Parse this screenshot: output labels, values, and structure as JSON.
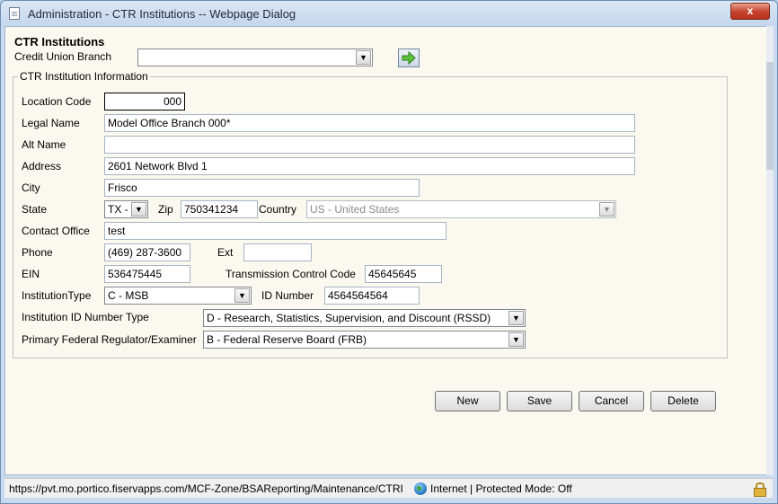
{
  "window": {
    "title": "Administration - CTR Institutions -- Webpage Dialog",
    "close_label": "x"
  },
  "page": {
    "heading": "CTR Institutions",
    "branch_label": "Credit Union Branch",
    "branch_value": ""
  },
  "section": {
    "legend": "CTR Institution Information"
  },
  "form": {
    "location_code": {
      "label": "Location Code",
      "value": "000"
    },
    "legal_name": {
      "label": "Legal Name",
      "value": "Model Office Branch 000*"
    },
    "alt_name": {
      "label": "Alt Name",
      "value": ""
    },
    "address": {
      "label": "Address",
      "value": "2601 Network Blvd 1"
    },
    "city": {
      "label": "City",
      "value": "Frisco"
    },
    "state": {
      "label": "State",
      "value": "TX -"
    },
    "zip": {
      "label": "Zip",
      "value": "750341234"
    },
    "country": {
      "label": "Country",
      "value": "US - United States"
    },
    "contact_office": {
      "label": "Contact Office",
      "value": "test"
    },
    "phone": {
      "label": "Phone",
      "value": "(469) 287-3600"
    },
    "ext": {
      "label": "Ext",
      "value": ""
    },
    "ein": {
      "label": "EIN",
      "value": "536475445"
    },
    "tcc": {
      "label": "Transmission Control Code",
      "value": "45645645"
    },
    "institution_type": {
      "label": "InstitutionType",
      "value": "C - MSB"
    },
    "id_number": {
      "label": "ID Number",
      "value": "4564564564"
    },
    "id_number_type": {
      "label": "Institution ID Number Type",
      "value": "D - Research, Statistics, Supervision, and Discount (RSSD)"
    },
    "regulator": {
      "label": "Primary Federal Regulator/Examiner",
      "value": "B - Federal Reserve Board (FRB)"
    }
  },
  "buttons": {
    "new": "New",
    "save": "Save",
    "cancel": "Cancel",
    "delete": "Delete"
  },
  "status": {
    "url": "https://pvt.mo.portico.fiservapps.com/MCF-Zone/BSAReporting/Maintenance/CTRI",
    "zone": "Internet | Protected Mode: Off"
  },
  "icons": {
    "go": "green-arrow-icon",
    "dropdown": "chevron-down-icon",
    "zone": "globe-icon",
    "security": "lock-icon"
  }
}
